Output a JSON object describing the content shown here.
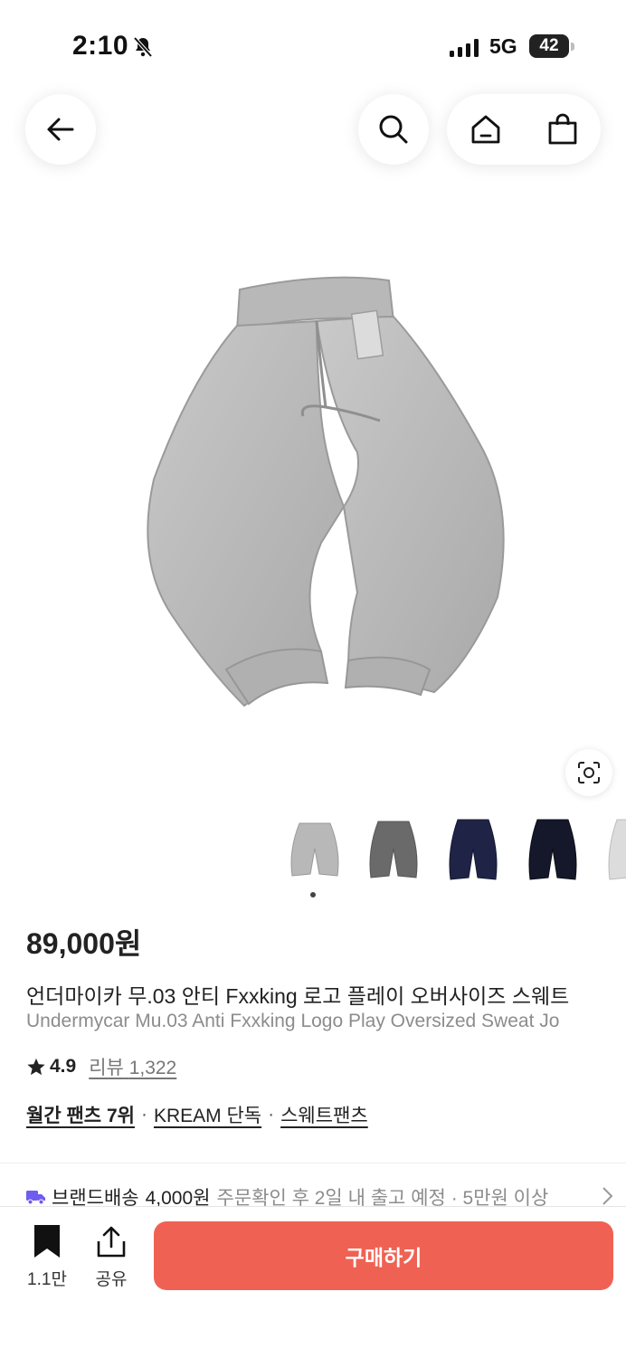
{
  "status_bar": {
    "time": "2:10",
    "network": "5G",
    "battery": "42"
  },
  "nav": {
    "back_icon": "arrow-left-icon",
    "search_icon": "search-icon",
    "home_icon": "home-icon",
    "cart_icon": "shopping-bag-icon"
  },
  "product": {
    "price": "89,000원",
    "title_ko": "언더마이카 무.03 안티 Fxxking 로고 플레이 오버사이즈 스웨트",
    "title_en": "Undermycar Mu.03 Anti Fxxking Logo Play Oversized Sweat Jo",
    "rating": "4.9",
    "review_label": "리뷰",
    "review_count": "1,322",
    "tags": [
      "월간 팬츠 7위",
      "KREAM 단독",
      "스웨트팬츠"
    ],
    "thumbnail_colors": [
      "#b6b6b6",
      "#6a6a6a",
      "#1f2447",
      "#14182a",
      "#dcdcdc"
    ]
  },
  "shipping": {
    "label": "브랜드배송",
    "cost": "4,000원",
    "detail": "주문확인 후 2일 내 출고 예정 · 5만원 이상"
  },
  "bottom": {
    "bookmark_count": "1.1만",
    "share_label": "공유",
    "buy_label": "구매하기"
  },
  "colors": {
    "buy_button": "#ef6253",
    "shipping_icon": "#6f5cf0"
  }
}
